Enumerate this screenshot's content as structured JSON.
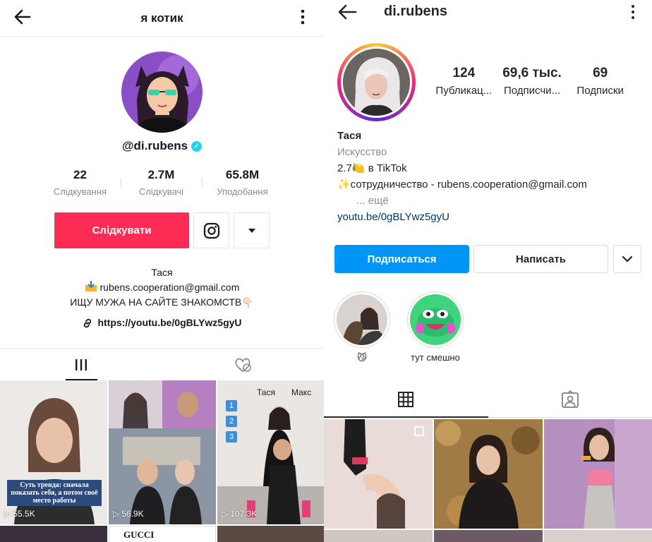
{
  "tiktok": {
    "title": "я котик",
    "username": "@di.rubens",
    "stats": [
      {
        "value": "22",
        "label": "Слідкування"
      },
      {
        "value": "2.7M",
        "label": "Слідкувачі"
      },
      {
        "value": "65.8M",
        "label": "Уподобання"
      }
    ],
    "follow_label": "Слідкувати",
    "bio": {
      "name": "Тася",
      "email": "rubens.cooperation@gmail.com",
      "line": "ИЩУ МУЖА НА САЙТЕ ЗНАКОМСТВ👇🏻",
      "link": "https://youtu.be/0gBLYwz5gyU"
    },
    "videos": [
      {
        "views": "55.5K",
        "caption": "Суть тренда: сначала показать себя, а потом своё место работы"
      },
      {
        "views": "56.9K"
      },
      {
        "views": "107.3K",
        "overlay_a": "Тася",
        "overlay_b": "Макс",
        "numbers": [
          "1",
          "2",
          "3"
        ]
      },
      {},
      {
        "brand_text": "GUCCI"
      },
      {}
    ]
  },
  "instagram": {
    "handle": "di.rubens",
    "stats": [
      {
        "value": "124",
        "label": "Публикац..."
      },
      {
        "value": "69,6 тыс.",
        "label": "Подписчи..."
      },
      {
        "value": "69",
        "label": "Подписки"
      }
    ],
    "bio": {
      "name": "Тася",
      "category": "Искусство",
      "line1": "2.7🍋 в TikTok",
      "line2": "✨сотрудничество - rubens.cooperation@gmail.com",
      "more": "... ещё",
      "url": "youtu.be/0gBLYwz5gyU"
    },
    "subscribe_label": "Подписаться",
    "message_label": "Написать",
    "highlights": [
      {
        "caption": "😼"
      },
      {
        "caption": "тут смешно"
      }
    ]
  },
  "colors": {
    "tiktok_red": "#fe2c55",
    "ig_blue": "#0095f6",
    "verified": "#20d5ec"
  }
}
